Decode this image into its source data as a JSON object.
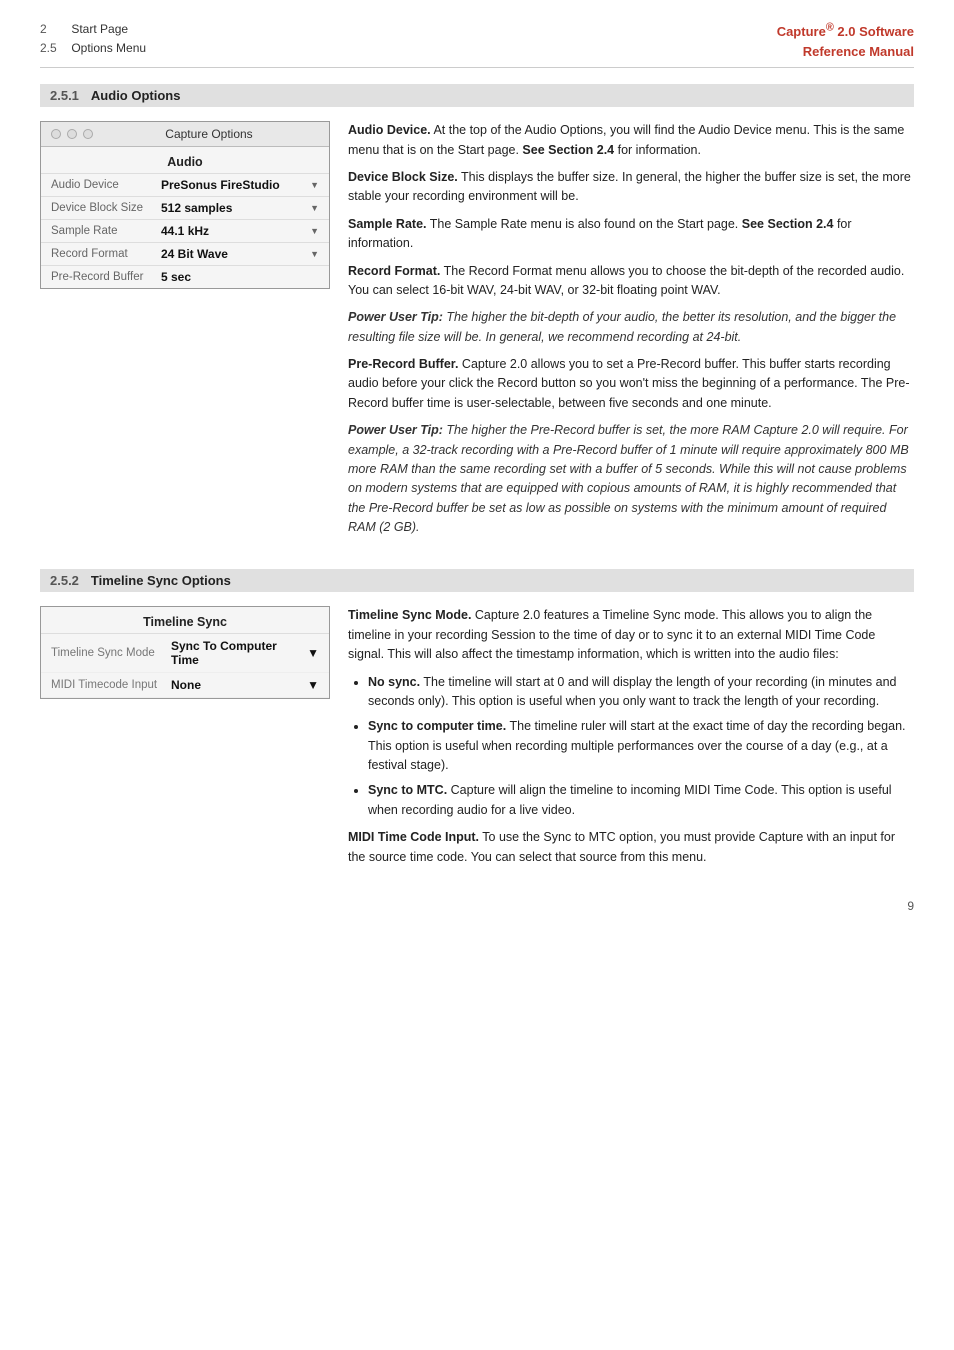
{
  "header": {
    "left": [
      {
        "num": "2",
        "label": "Start Page"
      },
      {
        "num": "2.5",
        "label": "Options Menu"
      }
    ],
    "right_line1": "Capture",
    "right_sup": "®",
    "right_line2": " 2.0 Software",
    "right_line3": "Reference Manual"
  },
  "section251": {
    "num": "2.5.1",
    "title": "Audio Options",
    "panel": {
      "titlebar": "Capture Options",
      "section_title": "Audio",
      "rows": [
        {
          "label": "Audio Device",
          "value": "PreSonus FireStudio",
          "has_arrow": true
        },
        {
          "label": "Device Block Size",
          "value": "512 samples",
          "has_arrow": true
        },
        {
          "label": "Sample Rate",
          "value": "44.1 kHz",
          "has_arrow": true
        },
        {
          "label": "Record Format",
          "value": "24 Bit Wave",
          "has_arrow": true
        },
        {
          "label": "Pre-Record Buffer",
          "value": "5 sec",
          "has_arrow": false
        }
      ]
    },
    "paragraphs": [
      {
        "id": "audio-device",
        "bold": "Audio Device.",
        "text": " At the top of the Audio Options, you will find the Audio Device menu. This is the same menu that is on the Start page. ",
        "bold2": "See Section 2.4",
        "text2": " for information."
      },
      {
        "id": "device-block-size",
        "bold": "Device Block Size.",
        "text": " This displays the buffer size. In general, the higher the buffer size is set, the more stable your recording environment will be."
      },
      {
        "id": "sample-rate",
        "bold": "Sample Rate.",
        "text": " The Sample Rate menu is also found on the Start page. ",
        "bold2": "See Section 2.4",
        "text2": " for information."
      },
      {
        "id": "record-format",
        "bold": "Record Format.",
        "text": " The Record Format menu allows you to choose the bit-depth of the recorded audio. You can select 16-bit WAV, 24-bit WAV, or 32-bit floating point WAV."
      },
      {
        "id": "power-tip-1",
        "is_power_tip": true,
        "bold": "Power User Tip:",
        "text": " The higher the bit-depth of your audio, the better its resolution, and the bigger the resulting file size will be. In general, we recommend recording at 24-bit."
      },
      {
        "id": "pre-record-buffer",
        "bold": "Pre-Record Buffer.",
        "text": " Capture 2.0 allows you to set a Pre-Record buffer. This buffer starts recording audio before your click the Record button so you won't miss the beginning of a performance. The Pre-Record buffer time is user-selectable, between five seconds and one minute."
      },
      {
        "id": "power-tip-2",
        "is_power_tip": true,
        "bold": "Power User Tip:",
        "text": " The higher the Pre-Record buffer is set, the more RAM Capture 2.0 will require. For example, a 32-track recording with a Pre-Record buffer of 1 minute will require approximately 800 MB more RAM than the same recording set with a buffer of 5 seconds. While this will not cause problems on modern systems that are equipped with copious amounts of RAM, it is highly recommended that the Pre-Record buffer be set as low as possible on systems with the minimum amount of required RAM (2 GB)."
      }
    ]
  },
  "section252": {
    "num": "2.5.2",
    "title": "Timeline Sync Options",
    "panel": {
      "section_title": "Timeline Sync",
      "rows": [
        {
          "label": "Timeline Sync Mode",
          "value": "Sync To Computer Time",
          "has_arrow": true
        },
        {
          "label": "MIDI Timecode Input",
          "value": "None",
          "has_arrow": true
        }
      ]
    },
    "paragraphs": [
      {
        "id": "timeline-sync-mode",
        "bold": "Timeline Sync Mode.",
        "text": " Capture 2.0 features a Timeline Sync mode. This allows you to align the timeline in your recording Session to the time of day or to sync it to an external MIDI Time Code signal. This will also affect the timestamp information, which is written into the audio files:"
      }
    ],
    "bullets": [
      {
        "bold": "No sync.",
        "text": " The timeline will start at 0 and will display the length of your recording (in minutes and seconds only). This option is useful when you only want to track the length of your recording."
      },
      {
        "bold": "Sync to computer time.",
        "text": " The timeline ruler will start at the exact time of day the recording began. This option is useful when recording multiple performances over the course of a day (e.g., at a festival stage)."
      },
      {
        "bold": "Sync to MTC.",
        "text": " Capture will align the timeline to incoming MIDI Time Code. This option is useful when recording audio for a live video."
      }
    ],
    "para_after": [
      {
        "id": "midi-timecode",
        "bold": "MIDI Time Code Input.",
        "text": " To use the Sync to MTC option, you must provide Capture with an input for the source time code. You can select that source from this menu."
      }
    ]
  },
  "page_number": "9"
}
